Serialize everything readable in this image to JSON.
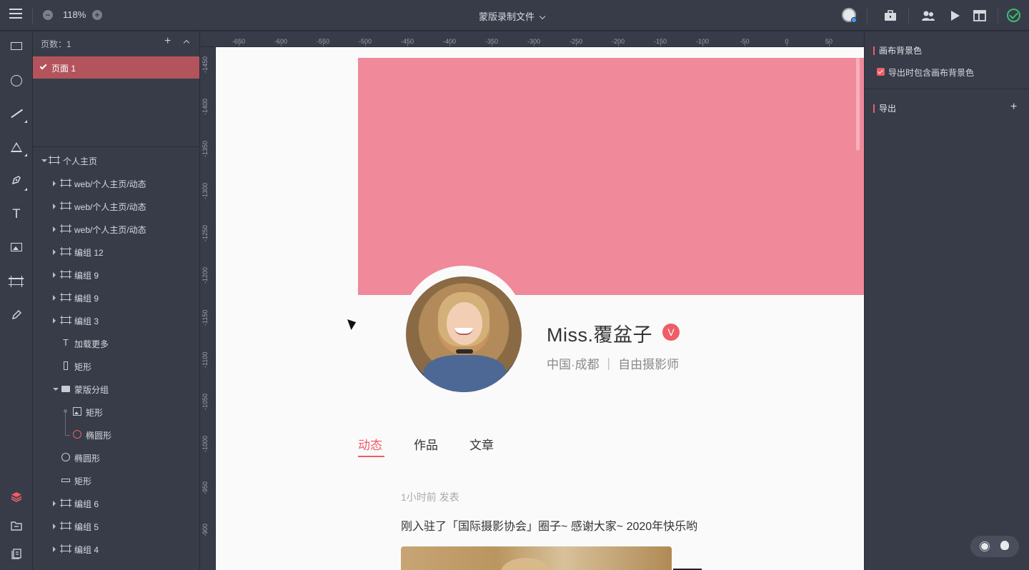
{
  "topbar": {
    "zoom_level": "118%",
    "zoom_out_icon": "minus-circle-icon",
    "zoom_in_icon": "plus-circle-icon",
    "document_title": "蒙版录制文件",
    "right_icons": [
      "avatar-icon",
      "toolbox-icon",
      "team-icon",
      "play-icon",
      "layout-icon",
      "saved-check-icon"
    ]
  },
  "tools": [
    "rectangle-tool",
    "ellipse-tool",
    "line-tool",
    "triangle-tool",
    "pen-tool",
    "text-tool",
    "image-tool",
    "artboard-tool",
    "pencil-tool",
    "layers-tool",
    "assets-tool",
    "components-tool"
  ],
  "pages": {
    "header_label": "页数：1",
    "items": [
      {
        "label": "页面 1",
        "selected": true
      }
    ]
  },
  "layers": [
    {
      "name": "个人主页",
      "icon": "artboard-icon",
      "indent": 0,
      "expanded": true
    },
    {
      "name": "web/个人主页/动态",
      "icon": "artboard-icon",
      "indent": 1
    },
    {
      "name": "web/个人主页/动态",
      "icon": "artboard-icon",
      "indent": 1
    },
    {
      "name": "web/个人主页/动态",
      "icon": "artboard-icon",
      "indent": 1
    },
    {
      "name": "编组 12",
      "icon": "artboard-icon",
      "indent": 1
    },
    {
      "name": "编组 9",
      "icon": "artboard-icon",
      "indent": 1
    },
    {
      "name": "编组 9",
      "icon": "artboard-icon",
      "indent": 1
    },
    {
      "name": "编组 3",
      "icon": "artboard-icon",
      "indent": 1
    },
    {
      "name": "加载更多",
      "icon": "text-icon",
      "indent": 1
    },
    {
      "name": "矩形",
      "icon": "rect-icon",
      "indent": 1
    },
    {
      "name": "蒙版分组",
      "icon": "folder-icon",
      "indent": 1,
      "expanded": true
    },
    {
      "name": "矩形",
      "icon": "image-icon",
      "indent": 2
    },
    {
      "name": "椭圆形",
      "icon": "ellipse-icon",
      "indent": 2
    },
    {
      "name": "椭圆形",
      "icon": "ellipse-icon",
      "indent": 1
    },
    {
      "name": "矩形",
      "icon": "rect-icon",
      "indent": 1
    },
    {
      "name": "编组 6",
      "icon": "artboard-icon",
      "indent": 1
    },
    {
      "name": "编组 5",
      "icon": "artboard-icon",
      "indent": 1
    },
    {
      "name": "编组 4",
      "icon": "artboard-icon",
      "indent": 1
    }
  ],
  "ruler": {
    "top_labels": [
      "-650",
      "-600",
      "-550",
      "-500",
      "-450",
      "-400",
      "-350",
      "-300",
      "-250",
      "-200",
      "-150",
      "-100",
      "-50",
      "0",
      "50"
    ],
    "left_labels": [
      "-1450",
      "-1400",
      "-1350",
      "-1300",
      "-1250",
      "-1200",
      "-1150",
      "-1100",
      "-1050",
      "-1000",
      "-950",
      "-900"
    ]
  },
  "canvas": {
    "banner_color": "#f0899a",
    "profile_name": "Miss.覆盆子",
    "verified_badge": "V",
    "profile_subtitle": "中国·成都 ｜ 自由摄影师",
    "tabs": [
      {
        "label": "动态",
        "active": true
      },
      {
        "label": "作品",
        "active": false
      },
      {
        "label": "文章",
        "active": false
      }
    ],
    "post_meta": "1小时前 发表",
    "post_text": "刚入驻了「国际摄影协会」圈子~ 感谢大家~ 2020年快乐哟"
  },
  "rightpanel": {
    "bg_section_title": "画布背景色",
    "include_bg_label": "导出时包含画布背景色",
    "include_bg_checked": true,
    "export_section_title": "导出",
    "accent_color": "#ef5d67"
  }
}
